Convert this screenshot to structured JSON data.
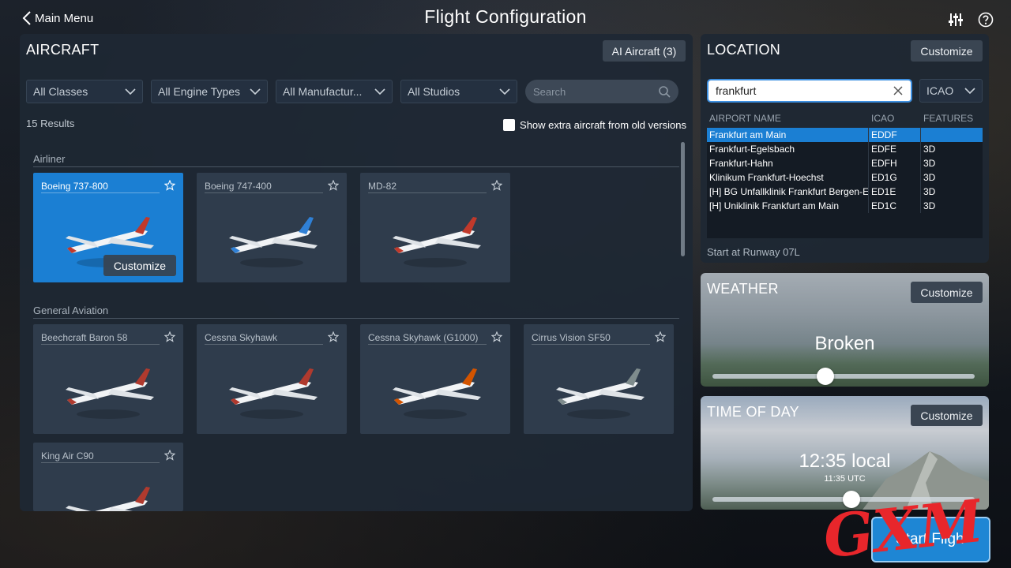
{
  "header": {
    "back_label": "Main Menu",
    "title": "Flight Configuration"
  },
  "aircraft": {
    "title": "AIRCRAFT",
    "ai_button": "AI Aircraft (3)",
    "filters": [
      "All Classes",
      "All Engine Types",
      "All Manufactur...",
      "All Studios"
    ],
    "search_placeholder": "Search",
    "results": "15 Results",
    "old_versions_label": "Show extra aircraft from old versions",
    "categories": [
      {
        "name": "Airliner",
        "items": [
          {
            "name": "Boeing 737-800",
            "selected": true,
            "customize": "Customize",
            "color": "#c0392b"
          },
          {
            "name": "Boeing 747-400",
            "selected": false,
            "color": "#2f80d6"
          },
          {
            "name": "MD-82",
            "selected": false,
            "color": "#c0392b"
          }
        ]
      },
      {
        "name": "General Aviation",
        "items": [
          {
            "name": "Beechcraft Baron 58",
            "selected": false,
            "color": "#b03a2e"
          },
          {
            "name": "Cessna Skyhawk",
            "selected": false,
            "color": "#b03a2e"
          },
          {
            "name": "Cessna Skyhawk (G1000)",
            "selected": false,
            "color": "#d35400"
          },
          {
            "name": "Cirrus Vision SF50",
            "selected": false,
            "color": "#7f8c8d"
          },
          {
            "name": "King Air C90",
            "selected": false,
            "color": "#b03a2e"
          }
        ]
      }
    ]
  },
  "location": {
    "title": "LOCATION",
    "customize": "Customize",
    "search_value": "frankfurt",
    "code_select": "ICAO",
    "columns": [
      "AIRPORT NAME",
      "ICAO",
      "FEATURES"
    ],
    "rows": [
      {
        "name": "Frankfurt am Main",
        "icao": "EDDF",
        "features": ""
      },
      {
        "name": "Frankfurt-Egelsbach",
        "icao": "EDFE",
        "features": "3D"
      },
      {
        "name": "Frankfurt-Hahn",
        "icao": "EDFH",
        "features": "3D"
      },
      {
        "name": "Klinikum Frankfurt-Hoechst",
        "icao": "ED1G",
        "features": "3D"
      },
      {
        "name": "[H] BG Unfallklinik Frankfurt Bergen-En",
        "icao": "ED1E",
        "features": "3D"
      },
      {
        "name": "[H] Uniklinik Frankfurt am Main",
        "icao": "ED1C",
        "features": "3D"
      }
    ],
    "selected_row": 0,
    "runway": "Start at Runway 07L"
  },
  "weather": {
    "title": "WEATHER",
    "customize": "Customize",
    "condition": "Broken",
    "slider_level": 0.43
  },
  "time_of_day": {
    "title": "TIME OF DAY",
    "customize": "Customize",
    "local": "12:35 local",
    "utc": "11:35 UTC",
    "slider_level": 0.53
  },
  "start_button": "Start Fligh",
  "watermark": "GXM",
  "colors": {
    "accent": "#1b7fd3",
    "panel": "#1e2834",
    "watermark": "#e8262b"
  }
}
